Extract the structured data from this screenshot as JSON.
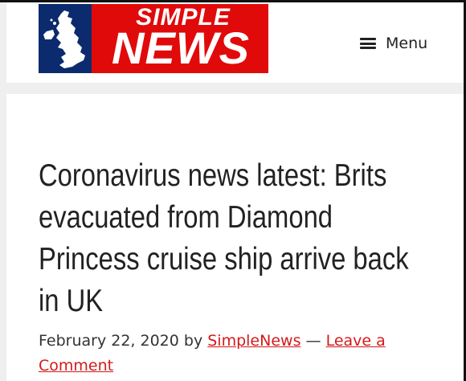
{
  "logo": {
    "line1": "SIMPLE",
    "line2": "NEWS",
    "map_icon": "uk-map-icon",
    "colors": {
      "red": "#e10a0a",
      "blue": "#0b2b6e"
    }
  },
  "nav": {
    "menu_label": "Menu",
    "menu_icon": "hamburger-icon"
  },
  "article": {
    "title": "Coronavirus news latest: Brits evacuated from Diamond Princess cruise ship arrive back in UK",
    "date": "February 22, 2020",
    "by": "by",
    "author": "SimpleNews",
    "separator": "—",
    "comment_link": "Leave a Comment"
  },
  "colors": {
    "link": "#d41a1a",
    "text": "#222222",
    "page_bg": "#efefef"
  }
}
